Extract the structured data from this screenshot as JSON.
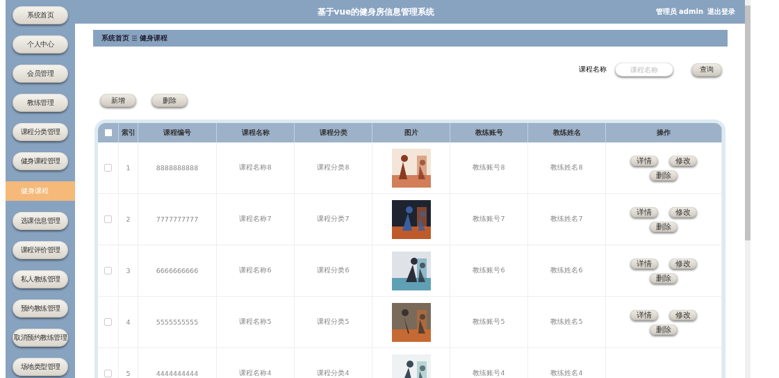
{
  "window": {
    "title": "基于vue的健身房信息管理系统"
  },
  "user": {
    "role": "管理员 admin",
    "logout": "退出登录"
  },
  "sidebar": {
    "items": [
      {
        "label": "系统首页",
        "selected": false
      },
      {
        "label": "个人中心",
        "selected": false
      },
      {
        "label": "会员管理",
        "selected": false
      },
      {
        "label": "教练管理",
        "selected": false
      },
      {
        "label": "课程分类管理",
        "selected": false
      },
      {
        "label": "健身课程管理",
        "selected": false,
        "children": [
          {
            "label": "健身课程",
            "selected": true
          }
        ]
      },
      {
        "label": "选课信息管理",
        "selected": false
      },
      {
        "label": "课程评价管理",
        "selected": false
      },
      {
        "label": "私人教练管理",
        "selected": false
      },
      {
        "label": "预约教练管理",
        "selected": false
      },
      {
        "label": "取消预约教练管理",
        "selected": false
      },
      {
        "label": "场地类型管理",
        "selected": false
      }
    ]
  },
  "breadcrumb": [
    "系统首页",
    "健身课程"
  ],
  "search": {
    "label": "课程名称",
    "placeholder": "课程名称",
    "button": "查询"
  },
  "toolbar": [
    "新增",
    "删除"
  ],
  "table": {
    "header_checkbox": {
      "checked": false
    },
    "columns": [
      "索引",
      "课程编号",
      "课程名称",
      "课程分类",
      "图片",
      "教练账号",
      "教练姓名",
      "操作"
    ],
    "rows": [
      {
        "checked": false,
        "index": "1",
        "code": "8888888888",
        "name": "课程名称8",
        "category": "课程分类8",
        "coach_account": "教练账号8",
        "coach_name": "教练姓名8",
        "actions": [
          "详情",
          "修改",
          "删除"
        ]
      },
      {
        "checked": false,
        "index": "2",
        "code": "7777777777",
        "name": "课程名称7",
        "category": "课程分类7",
        "coach_account": "教练账号7",
        "coach_name": "教练姓名7",
        "actions": [
          "详情",
          "修改",
          "删除"
        ]
      },
      {
        "checked": false,
        "index": "3",
        "code": "6666666666",
        "name": "课程名称6",
        "category": "课程分类6",
        "coach_account": "教练账号6",
        "coach_name": "教练姓名6",
        "actions": [
          "详情",
          "修改",
          "删除"
        ]
      },
      {
        "checked": false,
        "index": "4",
        "code": "5555555555",
        "name": "课程名称5",
        "category": "课程分类5",
        "coach_account": "教练账号5",
        "coach_name": "教练姓名5",
        "actions": [
          "详情",
          "修改",
          "删除"
        ]
      },
      {
        "checked": false,
        "index": "5",
        "code": "4444444444",
        "name": "课程名称4",
        "category": "课程分类4",
        "coach_account": "教练账号4",
        "coach_name": "教练姓名4"
      }
    ]
  }
}
